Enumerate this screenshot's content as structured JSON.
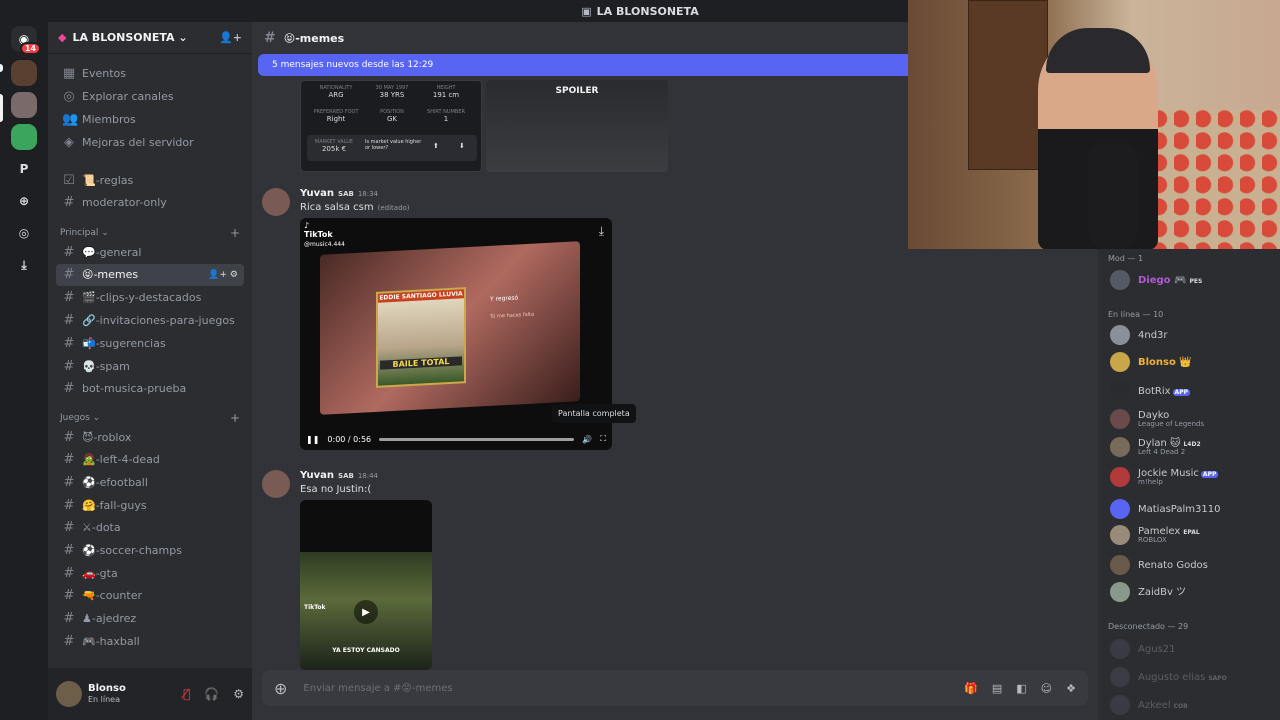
{
  "titlebar": {
    "title": "LA BLONSONETA"
  },
  "servers": {
    "dm_badge": "14",
    "p_label": "P"
  },
  "server": {
    "name": "LA BLONSONETA ⌄"
  },
  "nav": [
    {
      "icon": "calendar-icon",
      "label": "Eventos"
    },
    {
      "icon": "compass-icon",
      "label": "Explorar canales"
    },
    {
      "icon": "members-icon",
      "label": "Miembros"
    },
    {
      "icon": "boost-icon",
      "label": "Mejoras del servidor"
    }
  ],
  "channels_top": [
    "📜-reglas",
    "moderator-only"
  ],
  "categories": {
    "principal": "Principal ⌄",
    "juegos": "Juegos ⌄"
  },
  "principal_channels": [
    "💬-general",
    "😝-memes",
    "🎬-clips-y-destacados",
    "🔗-invitaciones-para-juegos",
    "📬-sugerencias",
    "💀-spam",
    "bot-musica-prueba"
  ],
  "juegos_channels": [
    "😈-roblox",
    "🧟-left-4-dead",
    "⚽-efootball",
    "🤗-fall-guys",
    "⚔-dota",
    "⚽-soccer-champs",
    "🚗-gta",
    "🔫-counter",
    "♟-ajedrez",
    "🎮-haxball"
  ],
  "user": {
    "name": "Blonso",
    "status": "En línea"
  },
  "chat": {
    "channel": "😝-memes",
    "new_messages": "5 mensajes nuevos desde las 12:29",
    "card": {
      "nat_label": "NATIONALITY",
      "nat": "ARG",
      "age_label": "30 MAY 1997",
      "age": "38 YRS",
      "h_label": "HEIGHT",
      "height": "191 cm",
      "foot_label": "PREFERRED FOOT",
      "foot": "Right",
      "pos_label": "POSITION",
      "pos": "GK",
      "shirt_label": "SHIRT NUMBER",
      "shirt": "1",
      "mv_label": "MARKET VALUE",
      "mv": "205k €",
      "q": "Is market value higher or lower?"
    },
    "spoiler": "SPOILER",
    "msg1": {
      "author": "Yuvan",
      "tag": "SAB",
      "time": "18:34",
      "text": "Rica salsa csm",
      "edited": "(editado)"
    },
    "video1": {
      "brand": "TikTok",
      "handle": "@music4.444",
      "title": "EDDIE SANTIAGO LLUVIA",
      "stamp": "BAILE TOTAL",
      "time": "0:00 / 0:56",
      "lyric1": "Y regresó",
      "lyric2": "Tú me haces falta"
    },
    "tooltip": "Pantalla completa",
    "msg2": {
      "author": "Yuvan",
      "tag": "SAB",
      "time": "18:44",
      "text": "Esa no Justin:("
    },
    "video2": {
      "caption": "YA ESTOY CANSADO",
      "brand": "TikTok"
    },
    "composer_placeholder": "Enviar mensaje a #😝-memes"
  },
  "members": {
    "mod_header": "Mod — 1",
    "mod": {
      "name": "Diego 🎮",
      "tag": "PES"
    },
    "online_header": "En línea — 10",
    "online": [
      {
        "name": "4nd3r",
        "sub": "",
        "tag": ""
      },
      {
        "name": "Blonso 👑",
        "sub": "",
        "tag": ""
      },
      {
        "name": "BotRix",
        "sub": "",
        "tag": "APP"
      },
      {
        "name": "Dayko",
        "sub": "League of Legends",
        "tag": ""
      },
      {
        "name": "Dylan 🐱",
        "sub": "Left 4 Dead 2",
        "tag": "L4D2"
      },
      {
        "name": "Jockie Music",
        "sub": "m!help",
        "tag": "APP"
      },
      {
        "name": "MatiasPalm3110",
        "sub": "",
        "tag": ""
      },
      {
        "name": "Pamelex",
        "sub": "ROBLOX",
        "tag": "EPAL"
      },
      {
        "name": "Renato Godos",
        "sub": "",
        "tag": ""
      },
      {
        "name": "ZaidBv ツ",
        "sub": "",
        "tag": ""
      }
    ],
    "offline_header": "Desconectado — 29",
    "offline": [
      {
        "name": "Agus21",
        "tag": ""
      },
      {
        "name": "Augusto elias",
        "tag": "SAPO"
      },
      {
        "name": "Azkeel",
        "tag": "COB"
      }
    ]
  }
}
